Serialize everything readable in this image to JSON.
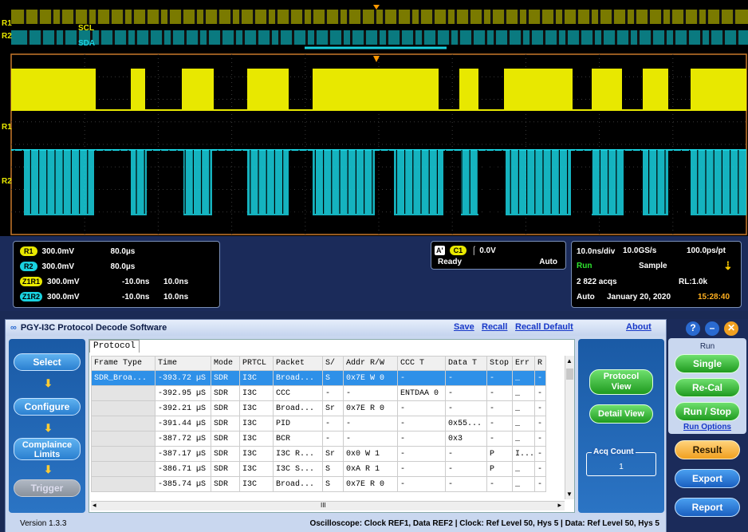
{
  "scope": {
    "ch1_label": "R1",
    "ch2_label": "R2",
    "scl_label": "SCL",
    "sda_label": "SDA",
    "colors": {
      "ch1": "#e8e800",
      "ch2": "#19d2e0",
      "grid": "#3a3a3a",
      "frame": "#c8782a"
    }
  },
  "readouts": {
    "ref": [
      {
        "chip": "R1",
        "volts": "300.0mV",
        "time": "80.0µs",
        "extra": ""
      },
      {
        "chip": "R2",
        "volts": "300.0mV",
        "time": "80.0µs",
        "extra": ""
      },
      {
        "chip": "Z1R1",
        "volts": "300.0mV",
        "time": "-10.0ns",
        "extra": "10.0ns"
      },
      {
        "chip": "Z1R2",
        "volts": "300.0mV",
        "time": "-10.0ns",
        "extra": "10.0ns"
      }
    ],
    "trigger": {
      "a": "A'",
      "ch": "C1",
      "level": "0.0V",
      "state": "Ready",
      "mode": "Auto"
    },
    "acq": {
      "timebase": "10.0ns/div",
      "rate": "10.0GS/s",
      "resolution": "100.0ps/pt",
      "run": "Run",
      "sample": "Sample",
      "acqs": "2 822 acqs",
      "rl": "RL:1.0k",
      "auto": "Auto",
      "date": "January 20, 2020",
      "time": "15:28:40"
    }
  },
  "app": {
    "title": "PGY-I3C Protocol Decode Software",
    "links": {
      "save": "Save",
      "recall": "Recall",
      "recall_default": "Recall Default",
      "about": "About"
    },
    "nav": {
      "select": "Select",
      "configure": "Configure",
      "compliance_1": "Complaince",
      "compliance_2": "Limits",
      "trigger": "Trigger"
    },
    "tab": "Protocol",
    "columns": [
      "Frame Type",
      "Time",
      "Mode",
      "PRTCL",
      "Packet",
      "S/",
      "Addr R/W",
      "CCC T",
      "Data T",
      "Stop",
      "Err",
      "R"
    ],
    "rows": [
      [
        "SDR_Broa...",
        "-393.72 µS",
        "SDR",
        "I3C",
        "Broad...",
        "S",
        "0x7E W 0",
        "-",
        "-",
        "-",
        "_",
        "-"
      ],
      [
        "",
        "-392.95 µS",
        "SDR",
        "I3C",
        "CCC",
        "-",
        "-",
        "ENTDAA 0",
        "-",
        "-",
        "_",
        "-"
      ],
      [
        "",
        "-392.21 µS",
        "SDR",
        "I3C",
        "Broad...",
        "Sr",
        "0x7E R 0",
        "-",
        "-",
        "-",
        "_",
        "-"
      ],
      [
        "",
        "-391.44 µS",
        "SDR",
        "I3C",
        "PID",
        "-",
        "-",
        "-",
        "0x55...",
        "-",
        "_",
        "-"
      ],
      [
        "",
        "-387.72 µS",
        "SDR",
        "I3C",
        "BCR",
        "-",
        "-",
        "-",
        "0x3",
        "-",
        "_",
        "-"
      ],
      [
        "",
        "-387.17 µS",
        "SDR",
        "I3C",
        "I3C R...",
        "Sr",
        "0x0 W 1",
        "-",
        "-",
        "P",
        "I...",
        "-"
      ],
      [
        "",
        "-386.71 µS",
        "SDR",
        "I3C",
        "I3C S...",
        "S",
        "0xA R 1",
        "-",
        "-",
        "P",
        "_",
        "-"
      ],
      [
        "",
        "-385.74 µS",
        "SDR",
        "I3C",
        "Broad...",
        "S",
        "0x7E R 0",
        "-",
        "-",
        "-",
        "_",
        "-"
      ]
    ],
    "scroll_mark": "III",
    "protocol_view_1": "Protocol",
    "protocol_view_2": "View",
    "detail_view": "Detail View",
    "acq_count_label": "Acq Count",
    "acq_count": "1",
    "version": "Version 1.3.3",
    "status": "Oscilloscope: Clock REF1, Data REF2 | Clock: Ref Level 50, Hys 5 | Data: Ref Level 50, Hys 5"
  },
  "run": {
    "help": "?",
    "min": "–",
    "close": "✕",
    "title": "Run",
    "single": "Single",
    "recal": "Re-Cal",
    "run_stop": "Run / Stop",
    "run_options": "Run Options",
    "result": "Result",
    "export": "Export",
    "report": "Report"
  }
}
